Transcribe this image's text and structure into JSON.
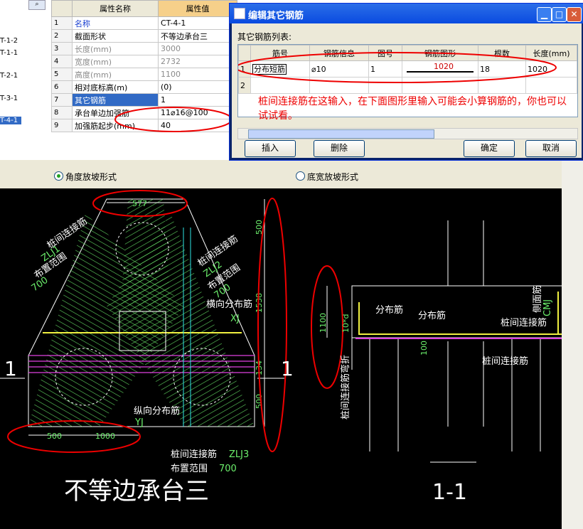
{
  "tree": {
    "items": [
      "T-1-2",
      "T-1-1",
      "T-2-1",
      "T-3-1",
      "T-4-1"
    ],
    "selected_index": 4
  },
  "properties": {
    "col_name": "属性名称",
    "col_value": "属性值",
    "rows": [
      {
        "idx": "1",
        "name": "名称",
        "value": "CT-4-1",
        "style": "blue"
      },
      {
        "idx": "2",
        "name": "截面形状",
        "value": "不等边承台三",
        "style": ""
      },
      {
        "idx": "3",
        "name": "长度(mm)",
        "value": "3000",
        "style": "gray"
      },
      {
        "idx": "4",
        "name": "宽度(mm)",
        "value": "2732",
        "style": "gray"
      },
      {
        "idx": "5",
        "name": "高度(mm)",
        "value": "1100",
        "style": "gray"
      },
      {
        "idx": "6",
        "name": "相对底标高(m)",
        "value": "(0)",
        "style": ""
      },
      {
        "idx": "7",
        "name": "其它钢筋",
        "value": "1",
        "style": "sel"
      },
      {
        "idx": "8",
        "name": "承台单边加强筋",
        "value": "11⌀16@100",
        "style": ""
      },
      {
        "idx": "9",
        "name": "加强筋起步(mm)",
        "value": "40",
        "style": ""
      }
    ]
  },
  "dialog": {
    "title": "编辑其它钢筋",
    "list_label": "其它钢筋列表:",
    "headers": [
      "筋号",
      "钢筋信息",
      "图号",
      "钢筋图形",
      "根数",
      "长度(mm)"
    ],
    "rows": [
      {
        "idx": "1",
        "name": "分布短筋",
        "info": "⌀10",
        "fig": "1",
        "shape_value": "1020",
        "count": "18",
        "length": "1020"
      },
      {
        "idx": "2",
        "name": "",
        "info": "",
        "fig": "",
        "shape_value": "",
        "count": "",
        "length": ""
      }
    ],
    "annotation": "桩间连接筋在这输入，在下面图形里输入可能会小算钢筋的，你也可以试试看。",
    "buttons": {
      "insert": "插入",
      "delete": "删除",
      "ok": "确定",
      "cancel": "取消"
    }
  },
  "radio": {
    "option1": "角度放坡形式",
    "option2": "底宽放坡形式",
    "selected": 1
  },
  "drawing": {
    "title_left": "不等边承台三",
    "title_right": "1-1",
    "section_mark": "1",
    "dims": {
      "top": "577",
      "right1": "500",
      "right2": "1538",
      "right3": "134",
      "right4": "500",
      "bottom1": "500",
      "bottom2": "1000",
      "height": "1100",
      "hook": "10*d",
      "small": "100"
    },
    "labels": {
      "zlj1_text": "桩间连接筋",
      "zlj1_code": "ZLJ1",
      "zlj1_range": "布置范围",
      "zlj1_val": "700",
      "zlj2_text": "桩间连接筋",
      "zlj2_code": "ZLJ2",
      "zlj2_range": "布置范围",
      "zlj2_val": "700",
      "heng": "横向分布筋",
      "xj": "XJ",
      "zong": "纵向分布筋",
      "yj": "YJ",
      "zlj3_text": "桩间连接筋",
      "zlj3_code": "ZLJ3",
      "zlj3_range": "布置范围",
      "zlj3_val": "700",
      "fenbu1": "分布筋",
      "fenbu2": "分布筋",
      "zhuang1": "桩间连接筋",
      "zhuang2": "桩间连接筋",
      "vertical_left": "桩间连接筋弯折",
      "vertical_right": "侧面筋",
      "cmj": "CMJ"
    }
  }
}
